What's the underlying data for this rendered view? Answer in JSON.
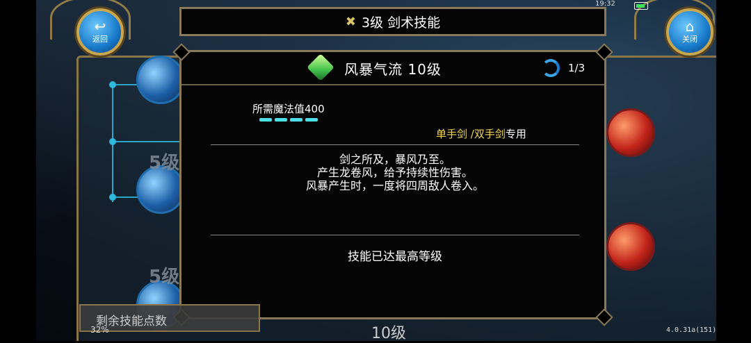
{
  "status_bar": {
    "time": "19:32"
  },
  "back_button": {
    "label": "返回"
  },
  "close_button": {
    "label": "关闭"
  },
  "header": {
    "title": "3级  剑术技能"
  },
  "dialog": {
    "skill_name": "风暴气流  10级",
    "page": "1/3",
    "mp_required": "所需魔法值400",
    "mp_bars": 4,
    "weapon_req_prefix": "单手剑 /双手剑",
    "weapon_req_suffix": "专用",
    "description_lines": [
      "剑之所及，暴风乃至。",
      "产生龙卷风，给予持续性伤害。",
      "风暴产生时，一度将四周敌人卷入。"
    ],
    "max_level_text": "技能已达最高等级"
  },
  "background": {
    "level_label_1": "5级",
    "level_label_2": "5级",
    "level_label_bottom": "10级"
  },
  "remaining_points": {
    "label": "剩余技能点数"
  },
  "footer": {
    "battery": "32%",
    "version": "4.0.31a(151)"
  },
  "colors": {
    "mp_bar": "#4ee0e8",
    "weapon_highlight": "#f2d64a",
    "frame": "#8a7a5a"
  }
}
